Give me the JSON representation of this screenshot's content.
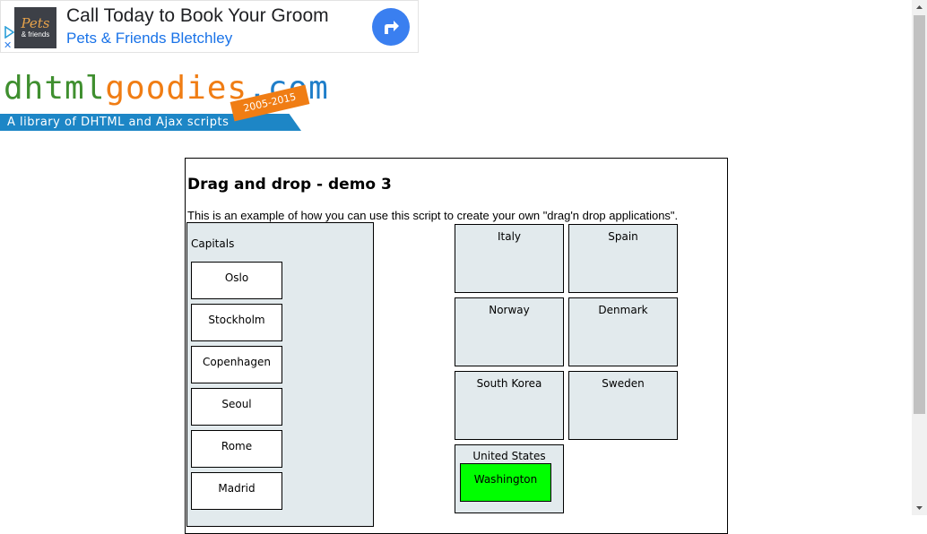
{
  "ad": {
    "logo_line1": "Pets",
    "logo_line2": "& friends",
    "headline": "Call Today to Book Your Groom",
    "subline": "Pets & Friends Bletchley",
    "close": "✕",
    "icons": {
      "info": "adchoices-icon",
      "close": "close-icon",
      "action": "directions-arrow-icon"
    },
    "colors": {
      "arrow_bg": "#3a7ff0",
      "subline": "#1a73e8"
    }
  },
  "logo": {
    "part1": "dhtml",
    "part2": "goodies",
    "part3": ".com",
    "tagline": "A library of DHTML and Ajax scripts",
    "years": "2005-2015",
    "colors": {
      "dhtml": "#3f8f2f",
      "goodies": "#f07d14",
      "com": "#1f7ec9",
      "bar": "#1d86c6"
    }
  },
  "demo": {
    "title": "Drag and drop - demo 3",
    "description": "This is an example of how you can use this script to create your own \"drag'n drop applications\".",
    "capitals_label": "Capitals",
    "capitals": [
      "Oslo",
      "Stockholm",
      "Copenhagen",
      "Seoul",
      "Rome",
      "Madrid"
    ],
    "countries": [
      "Italy",
      "Spain",
      "Norway",
      "Denmark",
      "South Korea",
      "Sweden",
      "United States"
    ],
    "placed": {
      "country": "United States",
      "capital": "Washington"
    },
    "colors": {
      "panel_bg": "#e2eaed",
      "correct_match": "#00ff00"
    }
  }
}
